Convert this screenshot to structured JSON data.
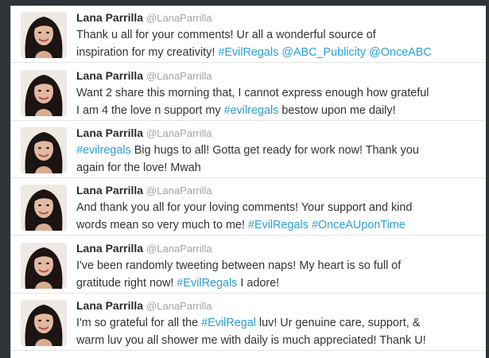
{
  "accent_color": "#2a9fd8",
  "tweets": [
    {
      "name": "Lana Parrilla",
      "handle": "@LanaParrilla",
      "lines": [
        [
          {
            "t": "Thank u all for your comments! Ur all a wonderful source of"
          }
        ],
        [
          {
            "t": "inspiration for my creativity! "
          },
          {
            "t": "#EvilRegals",
            "tag": true
          },
          {
            "t": " "
          },
          {
            "t": "@ABC_Publicity",
            "tag": true
          },
          {
            "t": " "
          },
          {
            "t": "@OnceABC",
            "tag": true
          }
        ]
      ]
    },
    {
      "name": "Lana Parrilla",
      "handle": "@LanaParrilla",
      "lines": [
        [
          {
            "t": "Want 2 share this morning that, I cannot express enough how grateful"
          }
        ],
        [
          {
            "t": "I am 4 the love n support my "
          },
          {
            "t": "#evilregals",
            "tag": true
          },
          {
            "t": " bestow upon me daily!"
          }
        ]
      ]
    },
    {
      "name": "Lana Parrilla",
      "handle": "@LanaParrilla",
      "lines": [
        [
          {
            "t": "#evilregals",
            "tag": true
          },
          {
            "t": " Big hugs to all! Gotta get ready for work now! Thank you"
          }
        ],
        [
          {
            "t": "again for the love! Mwah"
          }
        ]
      ]
    },
    {
      "name": "Lana Parrilla",
      "handle": "@LanaParrilla",
      "lines": [
        [
          {
            "t": "And thank you all for your loving comments! Your support and kind"
          }
        ],
        [
          {
            "t": "words mean so very much to me! "
          },
          {
            "t": "#EvilRegals",
            "tag": true
          },
          {
            "t": " "
          },
          {
            "t": "#OnceAUponTime",
            "tag": true
          }
        ]
      ]
    },
    {
      "name": "Lana Parrilla",
      "handle": "@LanaParrilla",
      "lines": [
        [
          {
            "t": "I've been randomly tweeting between naps! My heart is so full of"
          }
        ],
        [
          {
            "t": "gratitude right now! "
          },
          {
            "t": "#EvilRegals",
            "tag": true
          },
          {
            "t": " I adore!"
          }
        ]
      ]
    },
    {
      "name": "Lana Parrilla",
      "handle": "@LanaParrilla",
      "lines": [
        [
          {
            "t": "I'm so grateful for all the "
          },
          {
            "t": "#EvilRegal",
            "tag": true
          },
          {
            "t": " luv! Ur genuine care, support, &"
          }
        ],
        [
          {
            "t": "warm luv you all shower me with daily is much appreciated! Thank U!"
          }
        ]
      ]
    }
  ]
}
